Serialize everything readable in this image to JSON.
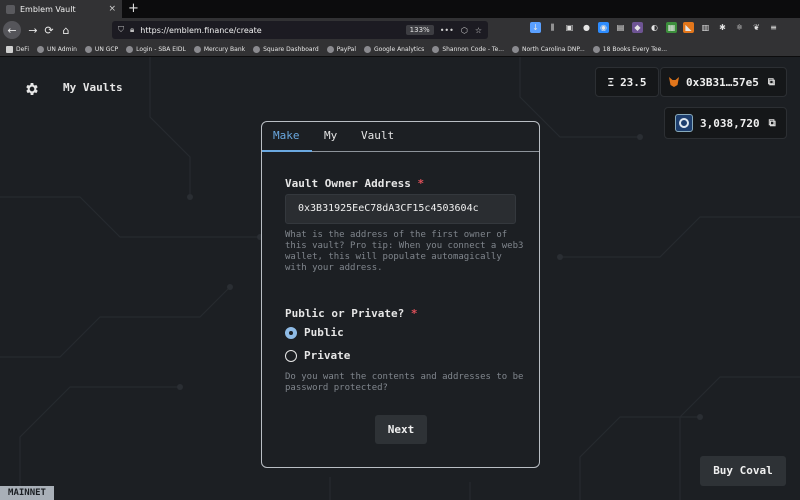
{
  "browser": {
    "tab_title": "Emblem Vault",
    "tab_close": "×",
    "new_tab": "+",
    "url": "https://emblem.finance/create",
    "zoom": "133%",
    "nav": {
      "back": "←",
      "forward": "→",
      "reload": "⟳",
      "home": "⌂"
    },
    "toolbar_icons": [
      {
        "name": "download-icon",
        "glyph": "↓",
        "color": "#5aa0ff"
      },
      {
        "name": "library-icon",
        "glyph": "⫼",
        "color": "transparent"
      },
      {
        "name": "reader-icon",
        "glyph": "▣",
        "color": "transparent"
      },
      {
        "name": "account-icon",
        "glyph": "●",
        "color": "transparent"
      },
      {
        "name": "zoom-ext-icon",
        "glyph": "◉",
        "color": "#2d8cff"
      },
      {
        "name": "screenshot-ext-icon",
        "glyph": "▤",
        "color": "transparent"
      },
      {
        "name": "github-ext-icon",
        "glyph": "◆",
        "color": "#6e5494"
      },
      {
        "name": "rss-ext-icon",
        "glyph": "◐",
        "color": "transparent"
      },
      {
        "name": "grid-ext-icon",
        "glyph": "▦",
        "color": "#3c8f3c"
      },
      {
        "name": "metamask-ext-icon",
        "glyph": "◣",
        "color": "#e2761b"
      },
      {
        "name": "calendar-ext-icon",
        "glyph": "▥",
        "color": "transparent"
      },
      {
        "name": "star-ext-icon",
        "glyph": "✱",
        "color": "transparent"
      },
      {
        "name": "react-ext-icon",
        "glyph": "⚛",
        "color": "transparent"
      },
      {
        "name": "leaf-ext-icon",
        "glyph": "❦",
        "color": "transparent"
      },
      {
        "name": "menu-icon",
        "glyph": "≡",
        "color": "transparent"
      }
    ]
  },
  "bookmarks": [
    "DeFi",
    "UN Admin",
    "UN GCP",
    "Login - SBA EIDL",
    "Mercury Bank",
    "Square Dashboard",
    "PayPal",
    "Google Analytics",
    "Shannon Code - Te...",
    "North Carolina DNP...",
    "18 Books Every Tee..."
  ],
  "header": {
    "title": "My Vaults",
    "balance_symbol": "Ξ",
    "balance": "23.5",
    "account": "0x3B31…57e5",
    "token_balance": "3,038,720",
    "external_link_glyph": "⧉"
  },
  "form": {
    "tabs": [
      "Make",
      "My",
      "Vault"
    ],
    "owner_label": "Vault Owner Address",
    "required_mark": "*",
    "owner_value": "0x3B31925EeC78dA3CF15c4503604c",
    "owner_help": "What is the address of the first owner of this vault? Pro tip: When you connect a web3 wallet, this will populate automagically with your address.",
    "privacy_label": "Public or Private?",
    "options": [
      "Public",
      "Private"
    ],
    "privacy_help": "Do you want the contents and addresses to be password protected?",
    "next_label": "Next"
  },
  "footer": {
    "buy_label": "Buy Coval",
    "network": "MAINNET"
  },
  "colors": {
    "accent": "#6aa8e0",
    "required": "#e0505a",
    "background": "#1c1f23"
  }
}
